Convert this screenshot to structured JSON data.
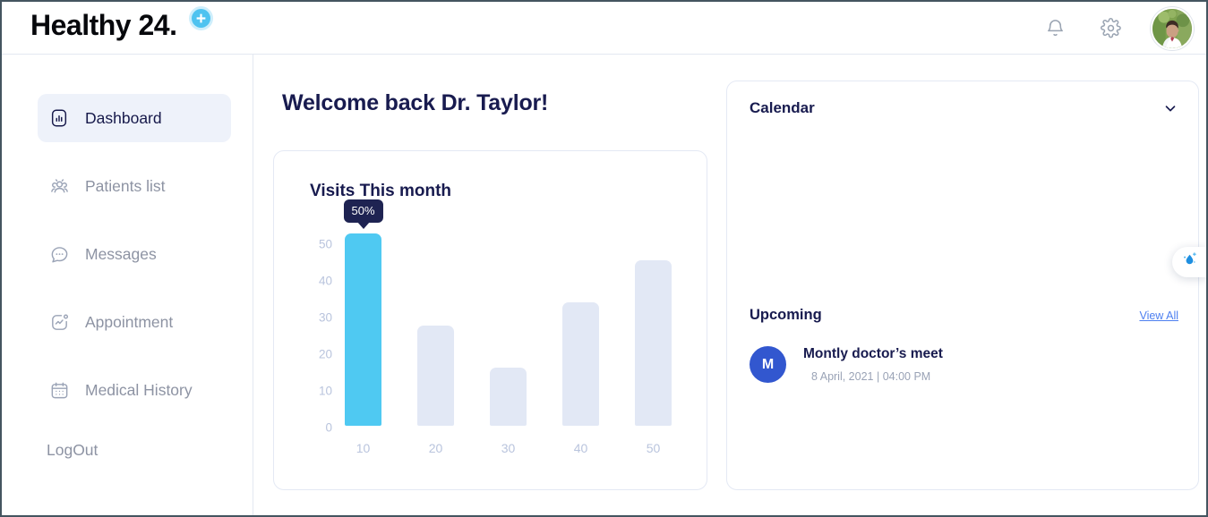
{
  "header": {
    "logo_text": "Healthy 24.",
    "logo_badge_icon": "medical-cross-icon",
    "notifications_icon": "bell-icon",
    "settings_icon": "gear-icon",
    "avatar_alt": "doctor-profile-photo"
  },
  "sidebar": {
    "items": [
      {
        "label": "Dashboard",
        "icon": "bar-chart-box-icon",
        "active": true
      },
      {
        "label": "Patients list",
        "icon": "users-group-icon",
        "active": false
      },
      {
        "label": "Messages",
        "icon": "chat-bubble-dots-icon",
        "active": false
      },
      {
        "label": "Appointment",
        "icon": "activity-box-icon",
        "active": false
      },
      {
        "label": "Medical History",
        "icon": "calendar-icon",
        "active": false
      }
    ],
    "logout_label": "LogOut"
  },
  "main": {
    "welcome_title": "Welcome back Dr. Taylor!"
  },
  "calendar": {
    "title": "Calendar",
    "collapse_icon": "chevron-down-icon",
    "upcoming_title": "Upcoming",
    "view_all_label": "View All",
    "events": [
      {
        "initial": "M",
        "name": "Montly doctor’s meet",
        "time": "8 April, 2021 | 04:00 PM"
      }
    ]
  },
  "floating_widget": {
    "icon": "water-drop-sparkle-icon"
  },
  "colors": {
    "accent_blue": "#4fc9f2",
    "bar_inactive": "#e2e8f5",
    "navy": "#181b4f",
    "tooltip_bg": "#1e2352",
    "link_blue": "#4d7ff0",
    "avatar_blue": "#3257cf",
    "active_nav_bg": "#eef2fa"
  },
  "chart_data": {
    "type": "bar",
    "title": "Visits This month",
    "categories": [
      "10",
      "20",
      "30",
      "40",
      "50"
    ],
    "values": [
      50,
      26,
      15,
      32,
      43
    ],
    "highlight_index": 0,
    "highlight_label": "50%",
    "xlabel": "",
    "ylabel": "",
    "ylim": [
      0,
      50
    ],
    "yticks": [
      "50",
      "40",
      "30",
      "20",
      "10",
      "0"
    ],
    "grid": false,
    "legend": "none"
  }
}
